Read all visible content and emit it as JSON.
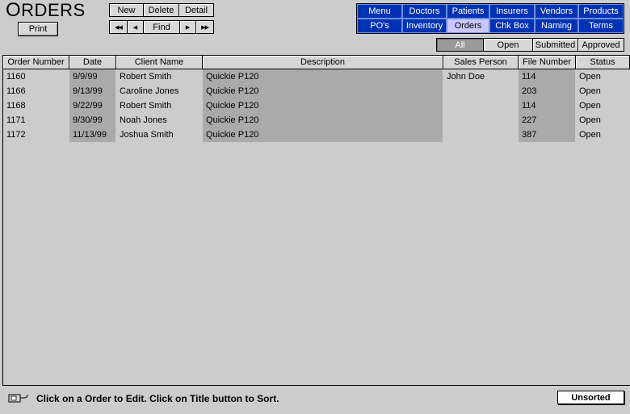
{
  "page": {
    "title_first": "O",
    "title_rest": "RDERS"
  },
  "toolbar": {
    "print": "Print",
    "new": "New",
    "delete": "Delete",
    "detail": "Detail",
    "first": "◀◀",
    "prev": "◀",
    "find": "Find",
    "next": "▶",
    "last": "▶▶"
  },
  "nav": {
    "row1": [
      "Menu",
      "Doctors",
      "Patients",
      "Insurers",
      "Vendors",
      "Products"
    ],
    "row2": [
      "PO's",
      "Inventory",
      "Orders",
      "Chk Box",
      "Naming",
      "Terms"
    ],
    "active": "Orders"
  },
  "filter": {
    "items": [
      "All",
      "Open",
      "Submitted",
      "Approved"
    ],
    "active": "All"
  },
  "table": {
    "columns": [
      "Order Number",
      "Date",
      "Client Name",
      "Description",
      "Sales Person",
      "File Number",
      "Status"
    ],
    "rows": [
      [
        "1160",
        "9/9/99",
        "Robert Smith",
        "Quickie P120",
        "John Doe",
        "114",
        "Open"
      ],
      [
        "1166",
        "9/13/99",
        "Caroline Jones",
        "Quickie P120",
        "",
        "203",
        "Open"
      ],
      [
        "1168",
        "9/22/99",
        "Robert Smith",
        "Quickie P120",
        "",
        "114",
        "Open"
      ],
      [
        "1171",
        "9/30/99",
        "Noah Jones",
        "Quickie P120",
        "",
        "227",
        "Open"
      ],
      [
        "1172",
        "11/13/99",
        "Joshua Smith",
        "Quickie P120",
        "",
        "387",
        "Open"
      ]
    ]
  },
  "footer": {
    "hint": "Click on a Order to Edit. Click on Title button to Sort.",
    "sort_state": "Unsorted"
  },
  "colors": {
    "nav_bg": "#0032b4",
    "nav_active": "#c8c8ff",
    "shade": "#aaaaaa",
    "bg": "#cccccc"
  }
}
